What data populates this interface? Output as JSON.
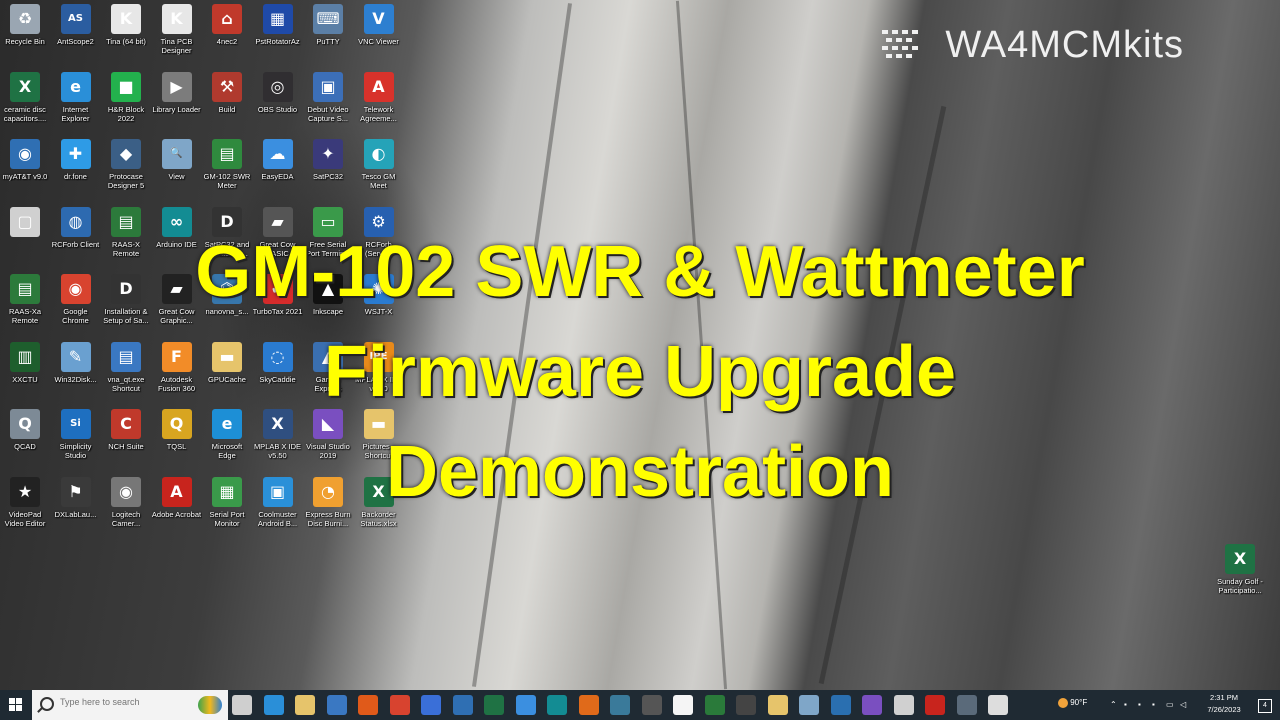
{
  "brand": {
    "text": "WA4MCMkits"
  },
  "title": {
    "line1": "GM-102 SWR & Wattmeter",
    "line2": "Firmware Upgrade",
    "line3": "Demonstration"
  },
  "desktop_icons": [
    {
      "label": "Recycle Bin",
      "icon": "recycle-bin-icon",
      "color": "#9aa6b2",
      "glyph": "♻"
    },
    {
      "label": "AntScope2",
      "icon": "antscope-icon",
      "color": "#2b5da0",
      "glyph": "AS"
    },
    {
      "label": "Tina (64 bit)",
      "icon": "tina-icon",
      "color": "#e7e7e7",
      "glyph": "K"
    },
    {
      "label": "Tina PCB Designer",
      "icon": "tina-pcb-icon",
      "color": "#e7e7e7",
      "glyph": "K"
    },
    {
      "label": "4nec2",
      "icon": "tower-icon",
      "color": "#c0392b",
      "glyph": "⌂"
    },
    {
      "label": "PstRotatorAz",
      "icon": "rotator-icon",
      "color": "#1f4aa8",
      "glyph": "▦"
    },
    {
      "label": "PuTTY",
      "icon": "putty-icon",
      "color": "#5b7fa6",
      "glyph": "⌨"
    },
    {
      "label": "VNC Viewer",
      "icon": "vnc-icon",
      "color": "#2d7fd0",
      "glyph": "V"
    },
    {
      "label": "ceramic disc capacitors....",
      "icon": "excel-icon",
      "color": "#1f7244",
      "glyph": "X"
    },
    {
      "label": "Internet Explorer",
      "icon": "ie-icon",
      "color": "#2a8fd8",
      "glyph": "e"
    },
    {
      "label": "H&R Block 2022",
      "icon": "hr-block-icon",
      "color": "#23b14d",
      "glyph": "■"
    },
    {
      "label": "Library Loader",
      "icon": "library-loader-icon",
      "color": "#7c7c7c",
      "glyph": "▶"
    },
    {
      "label": "Build",
      "icon": "build-icon",
      "color": "#b03a2e",
      "glyph": "⚒"
    },
    {
      "label": "OBS Studio",
      "icon": "obs-icon",
      "color": "#302e31",
      "glyph": "◎"
    },
    {
      "label": "Debut Video Capture S...",
      "icon": "debut-icon",
      "color": "#3c6fb8",
      "glyph": "▣"
    },
    {
      "label": "Telework Agreeme...",
      "icon": "pdf-icon",
      "color": "#d8322b",
      "glyph": "A"
    },
    {
      "label": "myAT&T v9.0",
      "icon": "att-icon",
      "color": "#2f6fb3",
      "glyph": "◉"
    },
    {
      "label": "dr.fone",
      "icon": "drfone-icon",
      "color": "#2e9be6",
      "glyph": "✚"
    },
    {
      "label": "Protocase Designer 5",
      "icon": "protocase-icon",
      "color": "#3b5f86",
      "glyph": "◆"
    },
    {
      "label": "View",
      "icon": "view-icon",
      "color": "#7fa6c8",
      "glyph": "🔍"
    },
    {
      "label": "GM-102 SWR Meter",
      "icon": "gm102-icon",
      "color": "#2f8a3e",
      "glyph": "▤"
    },
    {
      "label": "EasyEDA",
      "icon": "easyeda-icon",
      "color": "#3b8fe0",
      "glyph": "☁"
    },
    {
      "label": "SatPC32",
      "icon": "satellite-icon",
      "color": "#3a3a7a",
      "glyph": "✦"
    },
    {
      "label": "Tesco GM Meet",
      "icon": "meet-icon",
      "color": "#25a3b8",
      "glyph": "◐"
    },
    {
      "label": "",
      "icon": "blank-doc-icon",
      "color": "#d0d0d0",
      "glyph": "▢"
    },
    {
      "label": "RCForb Client",
      "icon": "rcforb-client-icon",
      "color": "#2d6ab0",
      "glyph": "◍"
    },
    {
      "label": "RAAS-X Remote",
      "icon": "raas-icon",
      "color": "#2c7a3b",
      "glyph": "▤"
    },
    {
      "label": "Arduino IDE",
      "icon": "arduino-icon",
      "color": "#138c93",
      "glyph": "∞"
    },
    {
      "label": "SatPC32 and Wisat32 M...",
      "icon": "satpc-doc-icon",
      "color": "#333333",
      "glyph": "D"
    },
    {
      "label": "Great Cow BASIC",
      "icon": "cow-icon",
      "color": "#555555",
      "glyph": "▰"
    },
    {
      "label": "Free Serial Port Terminal",
      "icon": "serial-terminal-icon",
      "color": "#3a9a4a",
      "glyph": "▭"
    },
    {
      "label": "RCForb (Server)",
      "icon": "rcforb-server-icon",
      "color": "#2760b0",
      "glyph": "⚙"
    },
    {
      "label": "RAAS-Xa Remote",
      "icon": "raas-xa-icon",
      "color": "#2c7a3b",
      "glyph": "▤"
    },
    {
      "label": "Google Chrome",
      "icon": "chrome-icon",
      "color": "#d8432f",
      "glyph": "◉"
    },
    {
      "label": "Installation & Setup of Sa...",
      "icon": "installation-doc-icon",
      "color": "#333333",
      "glyph": "D"
    },
    {
      "label": "Great Cow Graphic...",
      "icon": "cow-graphic-icon",
      "color": "#222222",
      "glyph": "▰"
    },
    {
      "label": "nanovna_s...",
      "icon": "python-icon",
      "color": "#3776ab",
      "glyph": "⌬"
    },
    {
      "label": "TurboTax 2021",
      "icon": "turbotax-icon",
      "color": "#d52b2b",
      "glyph": "✔"
    },
    {
      "label": "Inkscape",
      "icon": "inkscape-icon",
      "color": "#111111",
      "glyph": "▲"
    },
    {
      "label": "WSJT-X",
      "icon": "wsjtx-icon",
      "color": "#2a7bd0",
      "glyph": "✺"
    },
    {
      "label": "XXCTU",
      "icon": "xxctu-icon",
      "color": "#1e5e2d",
      "glyph": "▥"
    },
    {
      "label": "Win32Disk...",
      "icon": "win32disk-icon",
      "color": "#6aa0d0",
      "glyph": "✎"
    },
    {
      "label": "vna_qt.exe Shortcut",
      "icon": "vnaqt-icon",
      "color": "#3a78c2",
      "glyph": "▤"
    },
    {
      "label": "Autodesk Fusion 360",
      "icon": "fusion-icon",
      "color": "#f28c28",
      "glyph": "F"
    },
    {
      "label": "GPUCache",
      "icon": "folder-icon",
      "color": "#e6c46b",
      "glyph": "▬"
    },
    {
      "label": "SkyCaddie",
      "icon": "skycaddie-icon",
      "color": "#2a7bd0",
      "glyph": "◌"
    },
    {
      "label": "Garmin Express",
      "icon": "garmin-icon",
      "color": "#3a6fb0",
      "glyph": "◭"
    },
    {
      "label": "MPLAB X IPE v5.50",
      "icon": "mplab-ipe-icon",
      "color": "#e88a1a",
      "glyph": "IPE"
    },
    {
      "label": "QCAD",
      "icon": "qcad-icon",
      "color": "#7d8a96",
      "glyph": "Q"
    },
    {
      "label": "Simplicity Studio",
      "icon": "simplicity-icon",
      "color": "#1e6fc0",
      "glyph": "Si"
    },
    {
      "label": "NCH Suite",
      "icon": "nch-icon",
      "color": "#c0392b",
      "glyph": "C"
    },
    {
      "label": "TQSL",
      "icon": "tqsl-icon",
      "color": "#d8a520",
      "glyph": "Q"
    },
    {
      "label": "Microsoft Edge",
      "icon": "edge-icon",
      "color": "#1d8fd6",
      "glyph": "e"
    },
    {
      "label": "MPLAB X IDE v5.50",
      "icon": "mplab-ide-icon",
      "color": "#2f4f80",
      "glyph": "X"
    },
    {
      "label": "Visual Studio 2019",
      "icon": "visual-studio-icon",
      "color": "#7a4fc0",
      "glyph": "◣"
    },
    {
      "label": "Pictures - Shortcut",
      "icon": "pictures-folder-icon",
      "color": "#e6c46b",
      "glyph": "▬"
    },
    {
      "label": "VideoPad Video Editor",
      "icon": "videopad-icon",
      "color": "#222222",
      "glyph": "★"
    },
    {
      "label": "DXLabLau...",
      "icon": "dxlab-icon",
      "color": "#3a3a3a",
      "glyph": "⚑"
    },
    {
      "label": "Logitech Camer...",
      "icon": "logitech-icon",
      "color": "#777777",
      "glyph": "◉"
    },
    {
      "label": "Adobe Acrobat",
      "icon": "acrobat-icon",
      "color": "#c8241d",
      "glyph": "A"
    },
    {
      "label": "Serial Port Monitor",
      "icon": "serial-monitor-icon",
      "color": "#3a9a4a",
      "glyph": "▦"
    },
    {
      "label": "Coolmuster Android B...",
      "icon": "coolmuster-icon",
      "color": "#2a90d8",
      "glyph": "▣"
    },
    {
      "label": "Express Burn Disc Burni...",
      "icon": "express-burn-icon",
      "color": "#f0a030",
      "glyph": "◔"
    },
    {
      "label": "Backorder Status.xlsx",
      "icon": "excel-backorder-icon",
      "color": "#1f7244",
      "glyph": "X"
    },
    {
      "label": "Sunday Golf - Participatio...",
      "icon": "excel-golf-icon",
      "color": "#1f7244",
      "glyph": "X"
    }
  ],
  "taskbar": {
    "search_placeholder": "Type here to search",
    "weather": "90°F",
    "time": "2:31 PM",
    "date": "7/26/2023",
    "notifications": "4"
  }
}
